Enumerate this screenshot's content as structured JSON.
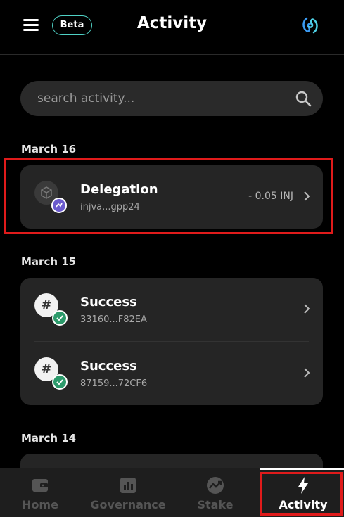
{
  "header": {
    "title": "Activity",
    "beta_label": "Beta"
  },
  "search": {
    "placeholder": "search activity..."
  },
  "groups": [
    {
      "date": "March 16",
      "items": [
        {
          "title": "Delegation",
          "subtitle": "injva...gpp24",
          "amount": "- 0.05 INJ"
        }
      ]
    },
    {
      "date": "March 15",
      "items": [
        {
          "title": "Success",
          "subtitle": "33160...F82EA"
        },
        {
          "title": "Success",
          "subtitle": "87159...72CF6"
        }
      ]
    },
    {
      "date": "March 14",
      "items": []
    }
  ],
  "nav": [
    {
      "label": "Home",
      "icon": "wallet-icon"
    },
    {
      "label": "Governance",
      "icon": "chart-icon"
    },
    {
      "label": "Stake",
      "icon": "stake-icon"
    },
    {
      "label": "Activity",
      "icon": "lightning-icon"
    }
  ],
  "colors": {
    "accent": "#4fd1c5",
    "highlight": "#e01b1b",
    "success": "#2c9a6b",
    "delegation": "#6a5acd"
  }
}
